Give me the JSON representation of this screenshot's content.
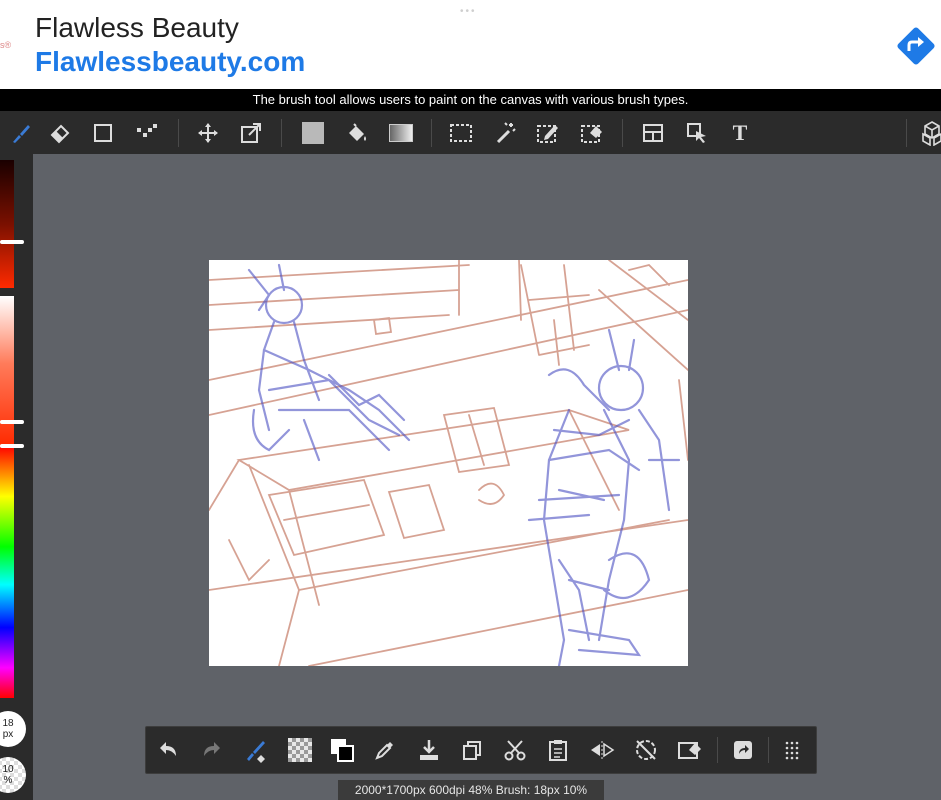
{
  "ad": {
    "title": "Flawless Beauty",
    "url": "Flawlessbeauty.com",
    "dots": "•••",
    "mark": "s®",
    "arrow_icon": "directions-arrow-icon",
    "accent": "#1e7ae6"
  },
  "tooltip": "The brush tool allows users to paint on the canvas with various brush types.",
  "toolbar": {
    "items": [
      {
        "icon": "brush-icon",
        "active": true
      },
      {
        "icon": "eraser-icon"
      },
      {
        "icon": "rectangle-icon"
      },
      {
        "icon": "dots-pattern-icon"
      },
      {
        "icon": "move-icon"
      },
      {
        "icon": "transform-icon"
      },
      {
        "icon": "fill-color-icon"
      },
      {
        "icon": "paint-bucket-icon"
      },
      {
        "icon": "gradient-icon"
      },
      {
        "icon": "select-rect-icon"
      },
      {
        "icon": "magic-wand-icon"
      },
      {
        "icon": "select-pen-icon"
      },
      {
        "icon": "select-eraser-icon"
      },
      {
        "icon": "frame-divider-icon"
      },
      {
        "icon": "select-layer-icon"
      },
      {
        "icon": "text-icon",
        "label": "T"
      },
      {
        "icon": "3d-cube-icon"
      }
    ],
    "text_tool_label": "T"
  },
  "colors": {
    "brush_blue": "#3a7bd5",
    "accent_red": "#ff2a00"
  },
  "left_panel": {
    "size_value": "18",
    "size_unit": "px",
    "opacity_value": "10",
    "opacity_unit": "%"
  },
  "bottom_toolbar": {
    "items": [
      {
        "icon": "undo-icon"
      },
      {
        "icon": "redo-icon"
      },
      {
        "icon": "brush-settings-icon"
      },
      {
        "icon": "transparency-icon"
      },
      {
        "icon": "swap-colors-icon"
      },
      {
        "icon": "eyedropper-icon"
      },
      {
        "icon": "download-icon"
      },
      {
        "icon": "copy-icon"
      },
      {
        "icon": "cut-icon"
      },
      {
        "icon": "paste-icon"
      },
      {
        "icon": "flip-icon"
      },
      {
        "icon": "rotate-disabled-icon"
      },
      {
        "icon": "clear-icon"
      },
      {
        "icon": "share-icon"
      },
      {
        "icon": "more-grid-icon"
      }
    ]
  },
  "status": "2000*1700px 600dpi 48% Brush: 18px 10%"
}
